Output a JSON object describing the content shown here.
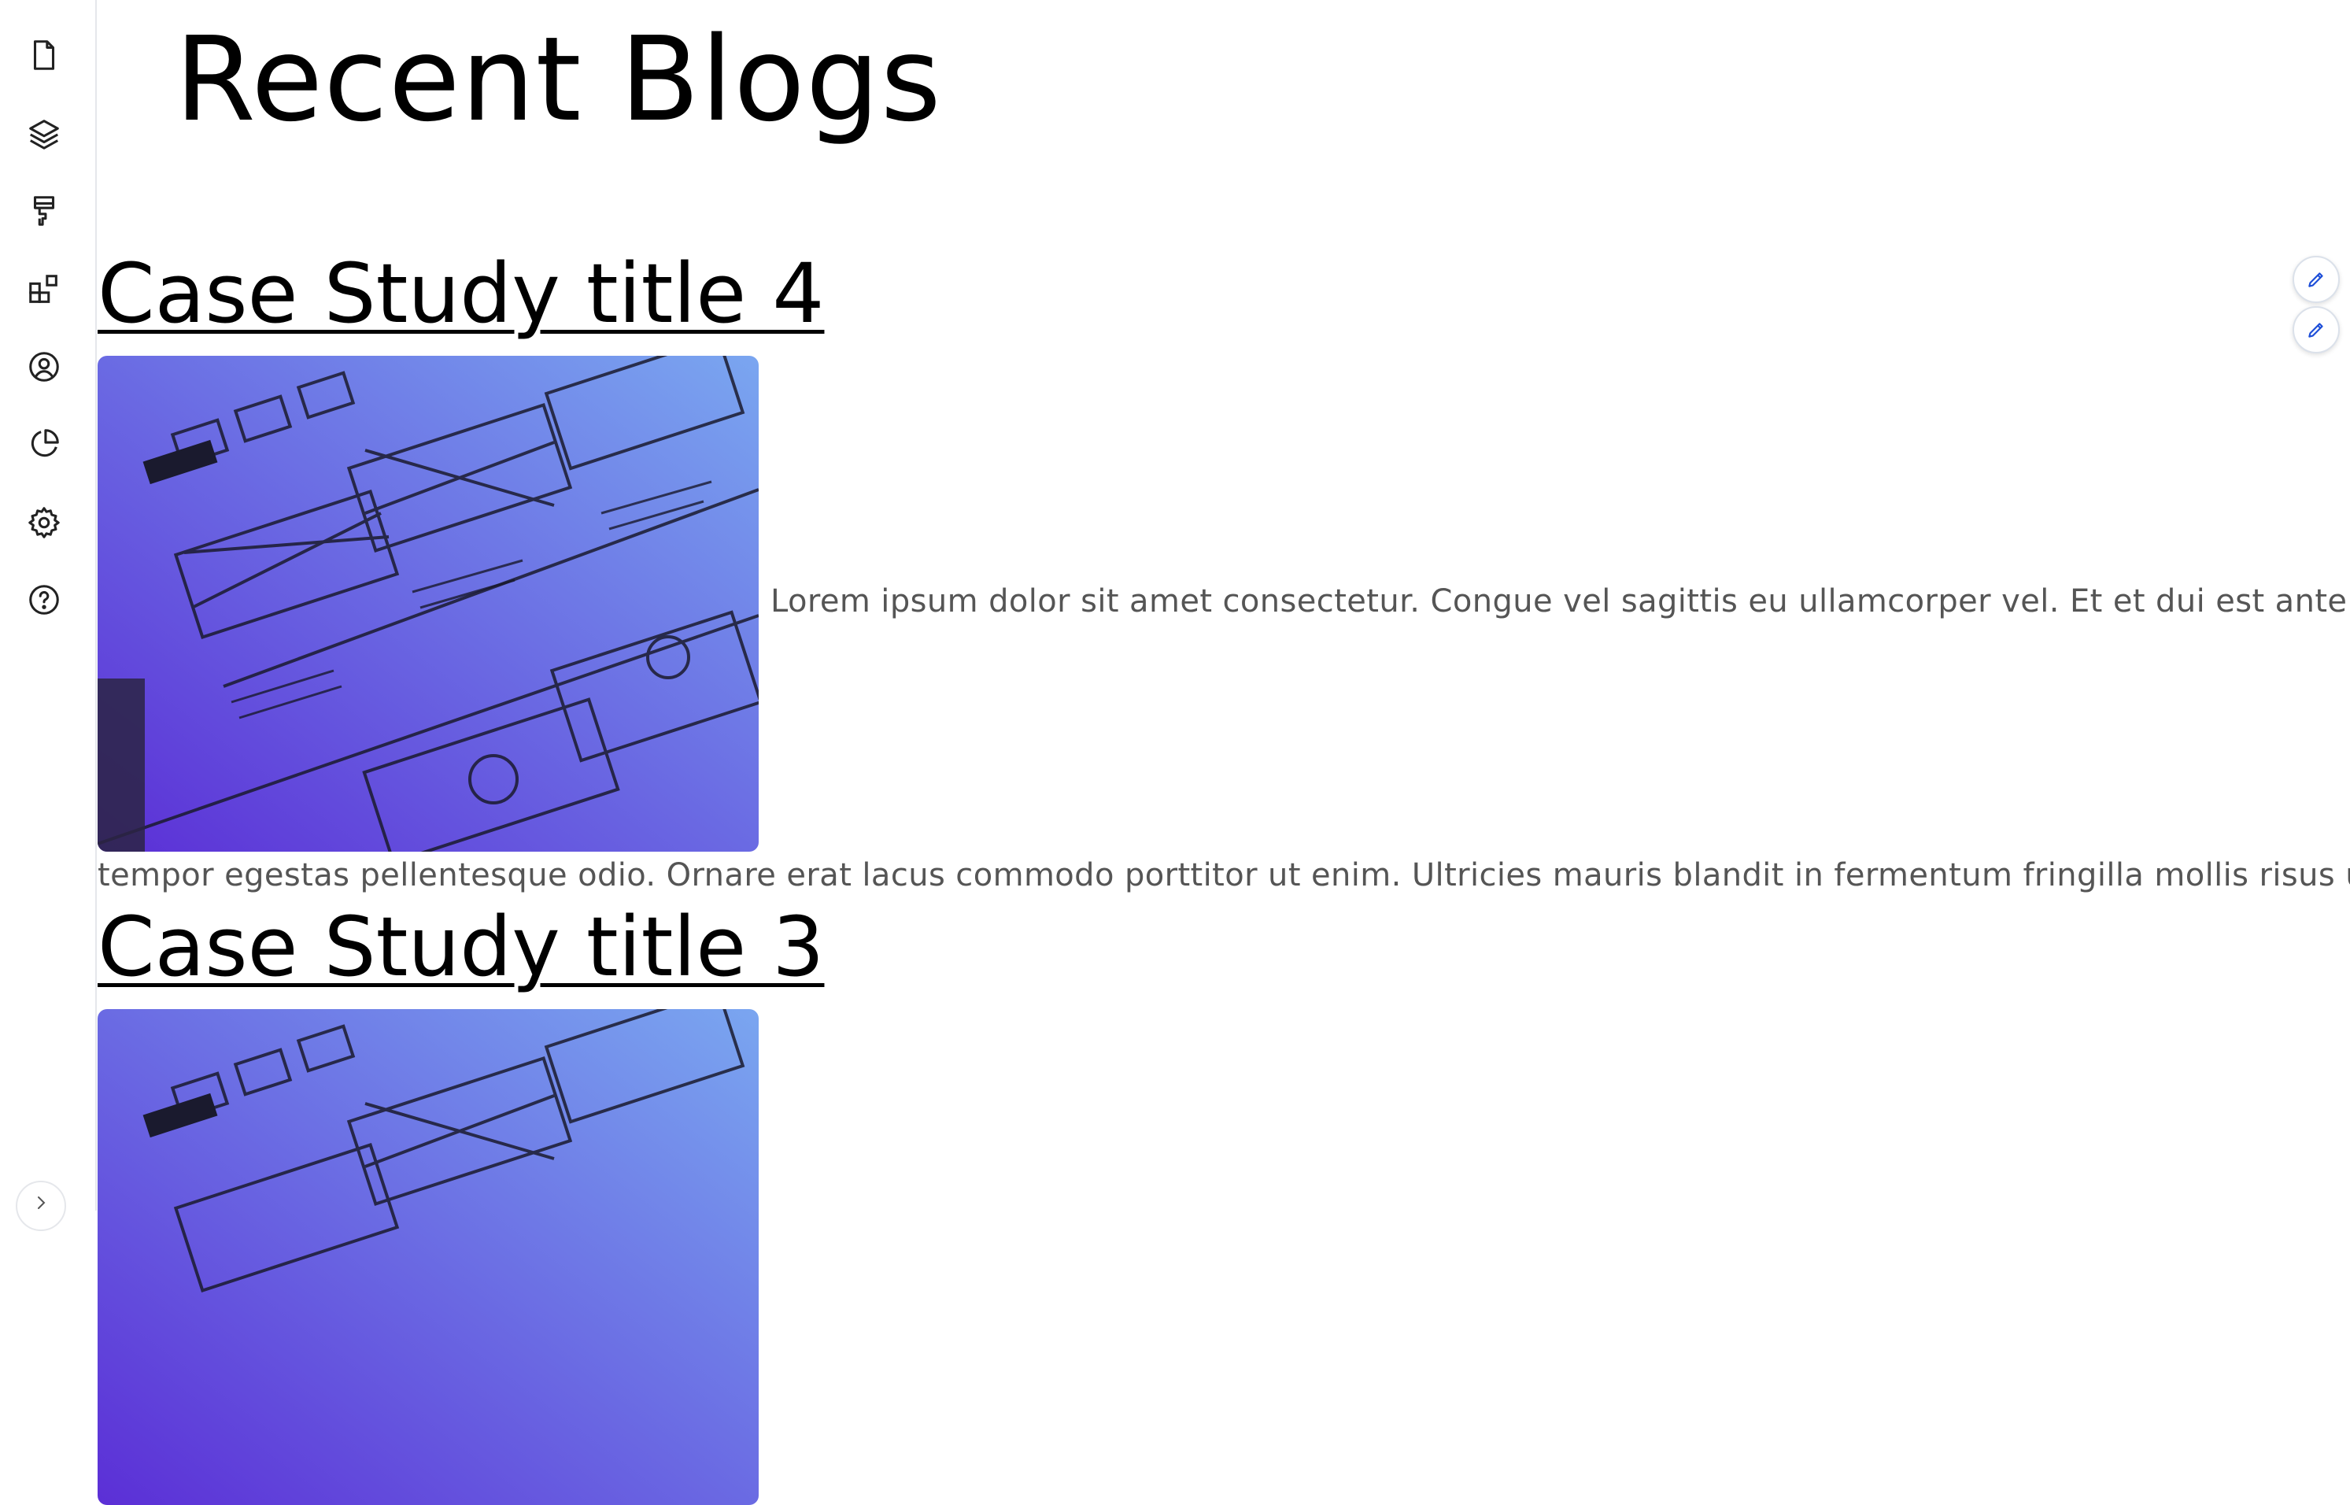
{
  "sidebar": {
    "icons": [
      "file-icon",
      "layers-icon",
      "paint-brush-icon",
      "widgets-icon",
      "user-circle-icon",
      "pie-chart-icon",
      "gear-icon",
      "help-circle-icon"
    ],
    "expand_icon": "chevron-right-icon"
  },
  "page": {
    "title": "Recent Blogs"
  },
  "posts": [
    {
      "title": "Case Study title 4",
      "excerpt_line_1": "Lorem ipsum dolor sit amet consectetur. Congue vel sagittis eu ullamcorper vel. Et et dui est ante",
      "excerpt_line_2": "tempor egestas pellentesque odio. Ornare erat lacus commodo porttitor ut enim. Ultricies mauris blandit in fermentum fringilla mollis risus ut."
    },
    {
      "title": "Case Study title 3"
    }
  ],
  "edit_buttons": {
    "icon": "pencil-icon",
    "color": "#1d4ed8"
  },
  "colors": {
    "thumb_gradient_start": "#5b2fd6",
    "thumb_gradient_end": "#7aa6f0",
    "excerpt_text": "#555555",
    "sidebar_border": "#e5e7eb"
  }
}
